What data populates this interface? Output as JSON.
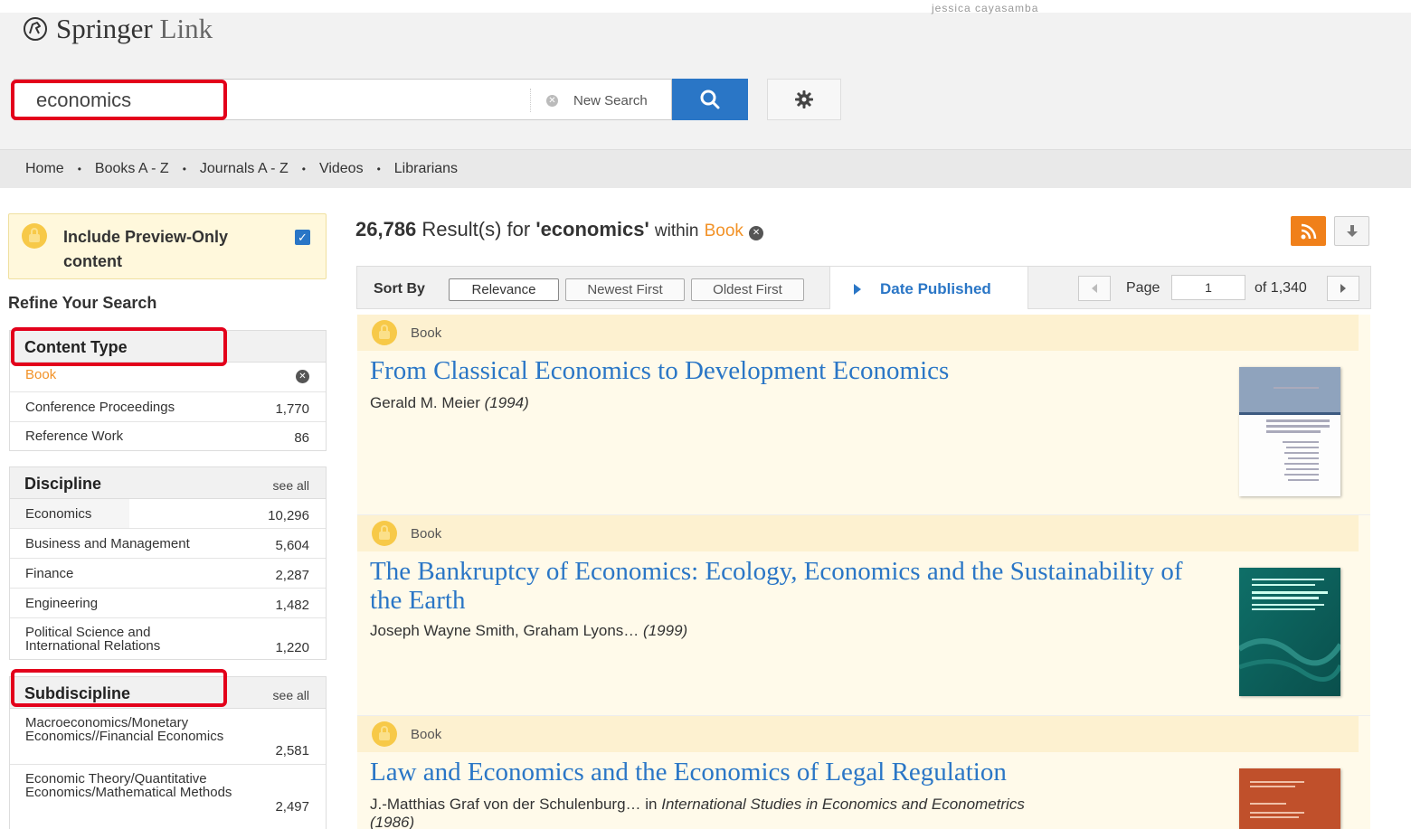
{
  "header": {
    "user_name": "jessica cayasamba",
    "logo_brand": "Springer",
    "logo_link": "Link"
  },
  "search": {
    "query": "economics",
    "new_search_label": "New Search",
    "search_icon": "magnifier-icon",
    "settings_icon": "gear-icon"
  },
  "nav": {
    "items": [
      "Home",
      "Books A - Z",
      "Journals A - Z",
      "Videos",
      "Librarians"
    ]
  },
  "sidebar": {
    "preview_label": "Include Preview-Only content",
    "preview_checked": true,
    "refine_title": "Refine Your Search",
    "content_type": {
      "title": "Content Type",
      "selected": "Book",
      "items": [
        {
          "name": "Conference Proceedings",
          "count": "1,770"
        },
        {
          "name": "Reference Work",
          "count": "86"
        }
      ]
    },
    "discipline": {
      "title": "Discipline",
      "see_all": "see all",
      "items": [
        {
          "name": "Economics",
          "count": "10,296"
        },
        {
          "name": "Business and Management",
          "count": "5,604"
        },
        {
          "name": "Finance",
          "count": "2,287"
        },
        {
          "name": "Engineering",
          "count": "1,482"
        },
        {
          "name": "Political Science and International Relations",
          "count": "1,220"
        }
      ]
    },
    "subdiscipline": {
      "title": "Subdiscipline",
      "see_all": "see all",
      "items": [
        {
          "name": "Macroeconomics/Monetary Economics//Financial Economics",
          "count": "2,581"
        },
        {
          "name": "Economic Theory/Quantitative Economics/Mathematical Methods",
          "count": "2,497"
        }
      ]
    }
  },
  "results": {
    "count": "26,786",
    "label": "Result(s) for",
    "query": "'economics'",
    "within": "within",
    "filter": "Book",
    "sort_by": "Sort By",
    "sort_options": [
      "Relevance",
      "Newest First",
      "Oldest First"
    ],
    "date_published": "Date Published",
    "page_label": "Page",
    "page": "1",
    "of_pages": "of 1,340",
    "items": [
      {
        "type": "Book",
        "title": "From Classical Economics to Development Economics",
        "authors": "Gerald M. Meier",
        "year": "(1994)"
      },
      {
        "type": "Book",
        "title": "The Bankruptcy of Economics: Ecology, Economics and the Sustainability of the Earth",
        "authors": "Joseph Wayne Smith, Graham Lyons…",
        "year": "(1999)"
      },
      {
        "type": "Book",
        "title": "Law and Economics and the Economics of Legal Regulation",
        "authors": "J.-Matthias Graf von der Schulenburg…",
        "in": "in",
        "series": "International Studies in Economics and Econometrics",
        "year": "(1986)"
      }
    ]
  },
  "colors": {
    "accent_blue": "#2a76c6",
    "orange": "#f29227",
    "highlight_red": "#e3001b"
  }
}
